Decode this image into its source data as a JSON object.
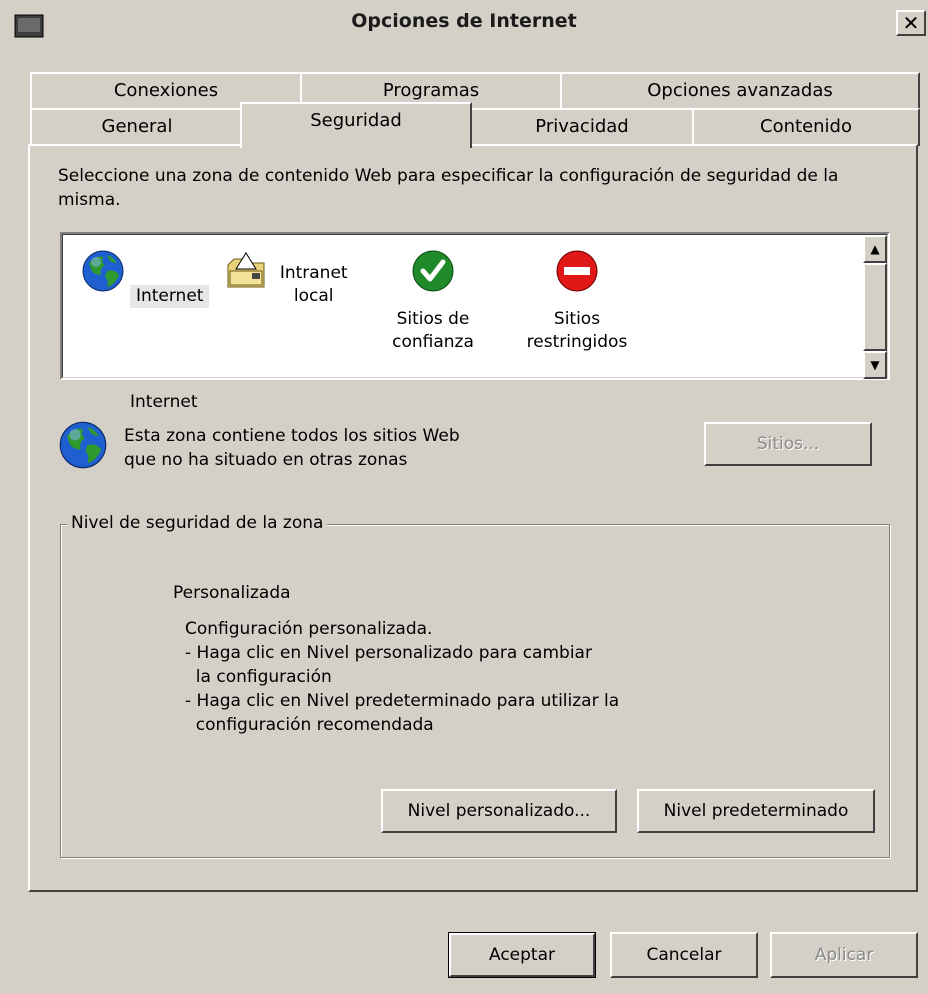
{
  "window": {
    "title": "Opciones de Internet",
    "close_label": "✕"
  },
  "tabs": {
    "row1": [
      "Conexiones",
      "Programas",
      "Opciones avanzadas"
    ],
    "row2": [
      "General",
      "Seguridad",
      "Privacidad",
      "Contenido"
    ],
    "active": "Seguridad"
  },
  "instructions": "Seleccione una zona de contenido Web para especificar la configuración de seguridad de la misma.",
  "zones": [
    {
      "label": "Internet",
      "icon": "globe-icon",
      "selected": true
    },
    {
      "label": "Intranet\nlocal",
      "icon": "intranet-folder-icon",
      "selected": false
    },
    {
      "label": "Sitios de\nconfianza",
      "icon": "trusted-check-icon",
      "selected": false
    },
    {
      "label": "Sitios\nrestringidos",
      "icon": "restricted-icon",
      "selected": false
    }
  ],
  "zone_info": {
    "name": "Internet",
    "description": "Esta zona contiene todos los sitios Web que no ha situado en otras zonas",
    "sites_button": "Sitios..."
  },
  "security_level": {
    "group_label": "Nivel de seguridad de la zona",
    "level_name": "Personalizada",
    "lines": [
      "Configuración personalizada.",
      "- Haga clic en Nivel personalizado para cambiar",
      "  la configuración",
      "- Haga clic en Nivel predeterminado para utilizar la",
      "  configuración recomendada"
    ],
    "custom_button": "Nivel personalizado...",
    "default_button": "Nivel predeterminado"
  },
  "footer": {
    "ok": "Aceptar",
    "cancel": "Cancelar",
    "apply": "Aplicar"
  },
  "colors": {
    "face": "#d4d0c8",
    "highlight": "#ffffff",
    "shadow": "#404040",
    "disabled_text": "#8a8a8a"
  }
}
